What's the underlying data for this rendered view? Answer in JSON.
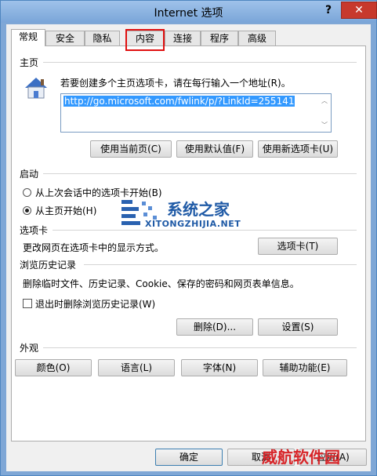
{
  "window": {
    "title": "Internet 选项",
    "help": "?",
    "close": "✕"
  },
  "tabs": [
    "常规",
    "安全",
    "隐私",
    "内容",
    "连接",
    "程序",
    "高级"
  ],
  "homepage": {
    "group": "主页",
    "prompt": "若要创建多个主页选项卡，请在每行输入一个地址(R)。",
    "url": "http://go.microsoft.com/fwlink/p/?LinkId=255141",
    "btn_current": "使用当前页(C)",
    "btn_default": "使用默认值(F)",
    "btn_newtab": "使用新选项卡(U)"
  },
  "startup": {
    "group": "启动",
    "opt1": "从上次会话中的选项卡开始(B)",
    "opt2": "从主页开始(H)",
    "selected": 2
  },
  "tabsgroup": {
    "group": "选项卡",
    "desc": "更改网页在选项卡中的显示方式。",
    "btn": "选项卡(T)"
  },
  "history": {
    "group": "浏览历史记录",
    "desc": "删除临时文件、历史记录、Cookie、保存的密码和网页表单信息。",
    "check": "退出时删除浏览历史记录(W)",
    "btn_delete": "删除(D)...",
    "btn_settings": "设置(S)"
  },
  "appearance": {
    "group": "外观",
    "btn_colors": "颜色(O)",
    "btn_languages": "语言(L)",
    "btn_fonts": "字体(N)",
    "btn_access": "辅助功能(E)"
  },
  "footer": {
    "ok": "确定",
    "cancel": "取消",
    "apply": "应用(A)"
  },
  "watermarks": {
    "site": "系统之家",
    "site_url": "XITONGZHIJIA.NET",
    "corner": "威航软件园"
  }
}
